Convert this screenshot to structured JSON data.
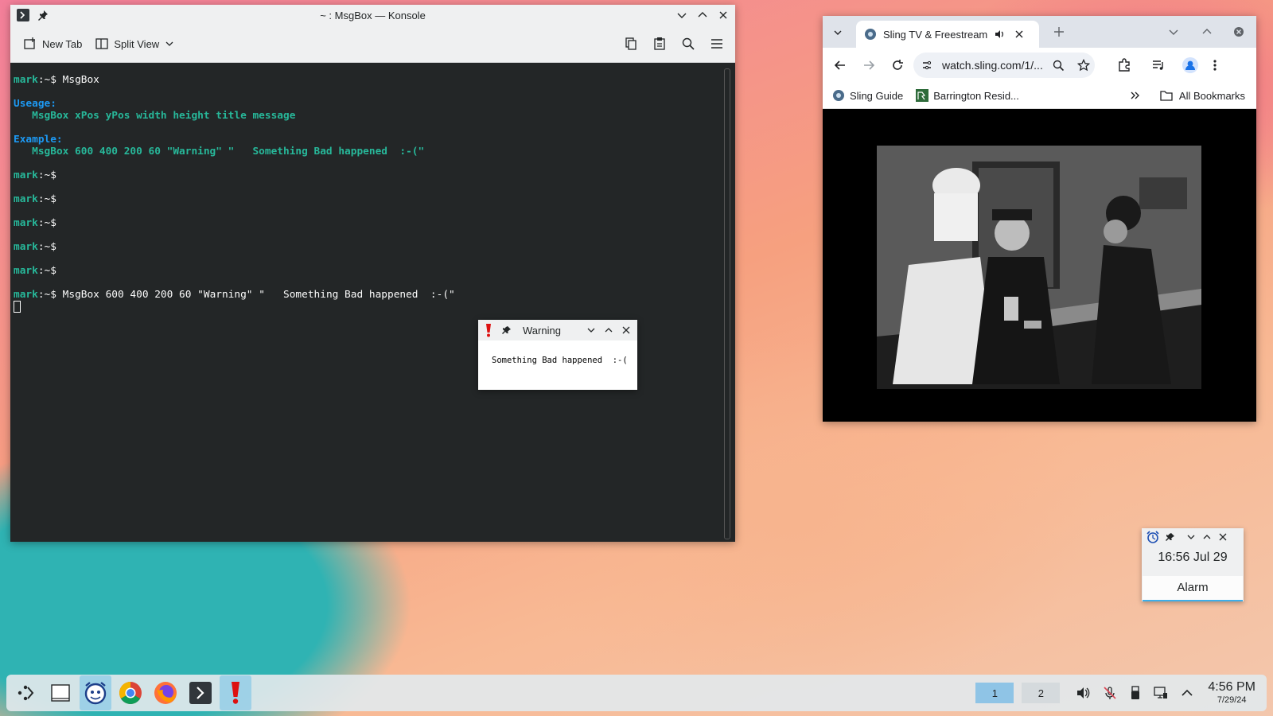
{
  "konsole": {
    "title": "~ : MsgBox — Konsole",
    "toolbar": {
      "new_tab": "New Tab",
      "split_view": "Split View"
    },
    "lines": [
      {
        "prompt": "mark",
        "suffix": ":~$",
        "cmd": " MsgBox"
      },
      {
        "blank": true
      },
      {
        "label": "Useage:"
      },
      {
        "indent": "   ",
        "text": "MsgBox xPos yPos width height title message"
      },
      {
        "blank": true
      },
      {
        "label": "Example:"
      },
      {
        "indent": "   ",
        "text": "MsgBox 600 400 200 60 \"Warning\" \"   Something Bad happened  :-(\""
      },
      {
        "blank": true
      },
      {
        "prompt": "mark",
        "suffix": ":~$",
        "cmd": ""
      },
      {
        "blank": true
      },
      {
        "prompt": "mark",
        "suffix": ":~$",
        "cmd": ""
      },
      {
        "blank": true
      },
      {
        "prompt": "mark",
        "suffix": ":~$",
        "cmd": ""
      },
      {
        "blank": true
      },
      {
        "prompt": "mark",
        "suffix": ":~$",
        "cmd": ""
      },
      {
        "blank": true
      },
      {
        "prompt": "mark",
        "suffix": ":~$",
        "cmd": ""
      },
      {
        "blank": true
      },
      {
        "prompt": "mark",
        "suffix": ":~$",
        "cmd": " MsgBox 600 400 200 60 \"Warning\" \"   Something Bad happened  :-(\""
      },
      {
        "cursor": true
      }
    ]
  },
  "msgbox": {
    "title": "Warning",
    "message": "Something Bad happened  :-("
  },
  "browser": {
    "tab_title": "Sling TV & Freestream L",
    "url": "watch.sling.com/1/...",
    "bookmarks": {
      "item1": "Sling Guide",
      "item2": "Barrington Resid...",
      "all": "All Bookmarks"
    }
  },
  "alarm": {
    "time": "16:56 Jul 29",
    "button": "Alarm"
  },
  "taskbar": {
    "pager": [
      "1",
      "2"
    ],
    "clock_time": "4:56 PM",
    "clock_date": "7/29/24"
  }
}
